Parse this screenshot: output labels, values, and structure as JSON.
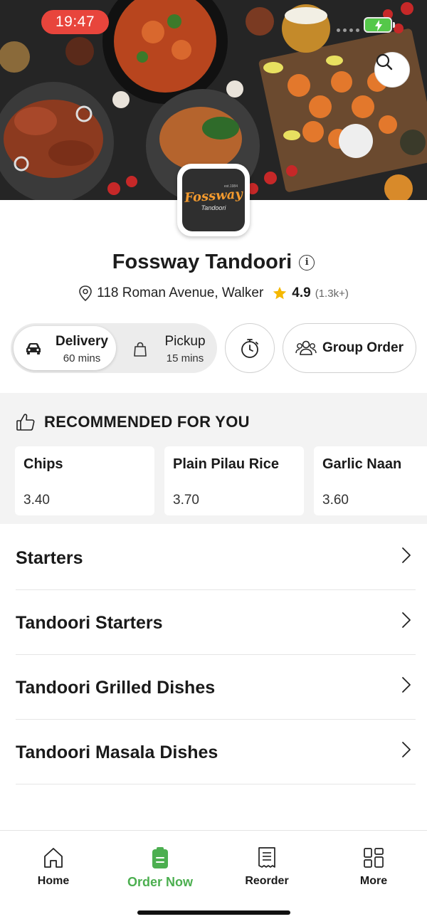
{
  "status_bar": {
    "time": "19:47"
  },
  "icons": {
    "search": "search-icon",
    "info": "info-icon",
    "location": "location-pin-icon",
    "star": "star-icon",
    "car": "car-icon",
    "bag": "shopping-bag-icon",
    "timer": "stopwatch-icon",
    "group": "group-icon",
    "thumbs_up": "thumbs-up-icon",
    "chevron": "chevron-right-icon"
  },
  "restaurant": {
    "logo_name": "Fossway",
    "logo_sub": "Tandoori",
    "logo_est": "est.1984",
    "name": "Fossway Tandoori",
    "info_glyph": "i",
    "address": "118 Roman Avenue, Walker",
    "rating": "4.9",
    "rating_count": "(1.3k+)"
  },
  "order_modes": {
    "delivery": {
      "label": "Delivery",
      "time": "60 mins"
    },
    "pickup": {
      "label": "Pickup",
      "time": "15 mins"
    },
    "group_order": "Group Order"
  },
  "recommended": {
    "title": "RECOMMENDED FOR YOU",
    "items": [
      {
        "name": "Chips",
        "price": "3.40"
      },
      {
        "name": "Plain Pilau Rice",
        "price": "3.70"
      },
      {
        "name": "Garlic Naan",
        "price": "3.60"
      }
    ]
  },
  "categories": [
    {
      "label": "Starters"
    },
    {
      "label": "Tandoori Starters"
    },
    {
      "label": "Tandoori Grilled Dishes"
    },
    {
      "label": "Tandoori Masala Dishes"
    }
  ],
  "bottom_nav": [
    {
      "label": "Home",
      "icon": "home-icon"
    },
    {
      "label": "Order Now",
      "icon": "order-icon"
    },
    {
      "label": "Reorder",
      "icon": "receipt-icon"
    },
    {
      "label": "More",
      "icon": "grid-icon"
    }
  ],
  "colors": {
    "accent_green": "#4caf50",
    "time_pill": "#e8453c",
    "logo_orange": "#f39a2e",
    "star": "#f5b800"
  }
}
